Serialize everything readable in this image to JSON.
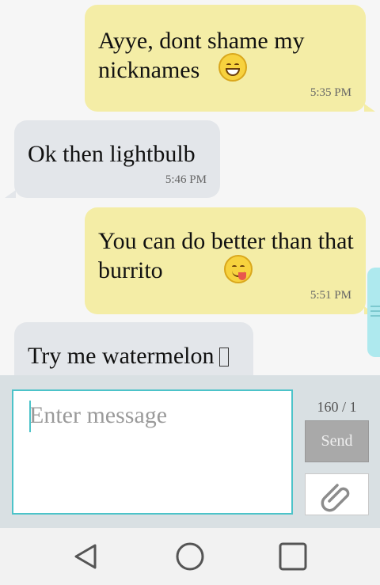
{
  "messages": [
    {
      "direction": "outgoing",
      "text": "Ayye, dont shame my nicknames",
      "emoji": "grinning-squint-face",
      "time": "5:35 PM"
    },
    {
      "direction": "incoming",
      "text": "Ok then lightbulb",
      "time": "5:46 PM"
    },
    {
      "direction": "outgoing",
      "text": "You can do better than that burrito",
      "emoji": "face-savoring-food",
      "time": "5:51 PM"
    },
    {
      "direction": "incoming",
      "text": "Try me watermelon",
      "emoji": "missing-glyph-box"
    }
  ],
  "composer": {
    "placeholder": "Enter message",
    "value": "",
    "counter": "160 / 1",
    "send_label": "Send",
    "attach_icon": "paperclip-icon"
  },
  "navbar": {
    "back_icon": "back-triangle-icon",
    "home_icon": "home-circle-icon",
    "recents_icon": "recents-square-icon"
  },
  "colors": {
    "outgoing_bubble": "#f4eda6",
    "incoming_bubble": "#e3e6ea",
    "accent": "#4cc3c9",
    "composer_bg": "#d9e0e3"
  }
}
